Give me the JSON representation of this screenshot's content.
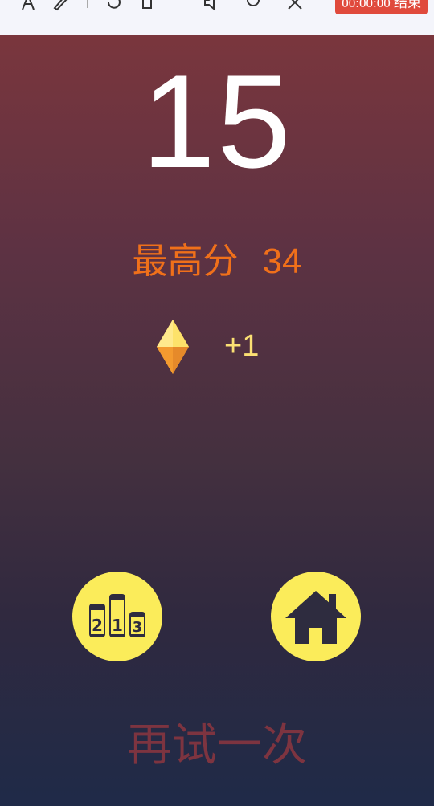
{
  "toolbar": {
    "record_button": "00:00:00 结束",
    "icons": [
      "text-icon",
      "pen-icon",
      "undo-icon",
      "trash-icon",
      "speaker-icon",
      "mic-icon",
      "close-icon"
    ]
  },
  "game": {
    "score": "15",
    "best_label": "最高分",
    "best_value": "34",
    "gem_reward": "+1",
    "rank_podium_digits": [
      "2",
      "1",
      "3"
    ],
    "retry_label": "再试一次",
    "colors": {
      "score": "#ffffff",
      "best": "#f0701a",
      "gem_text": "#fbe073",
      "button_bg": "#fbec5a",
      "button_icon": "#2e2c3f",
      "retry": "#7d3440"
    }
  }
}
